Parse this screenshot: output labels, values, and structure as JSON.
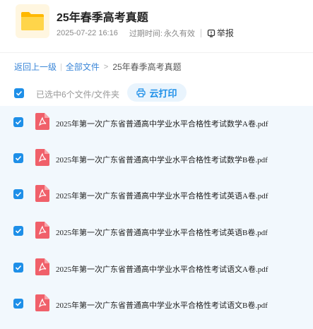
{
  "folder": {
    "title": "25年春季高考真题",
    "date": "2025-07-22 16:16",
    "expire_label": "过期时间:",
    "expire_value": "永久有效",
    "report_label": "举报"
  },
  "breadcrumb": {
    "back": "返回上一级",
    "all_files": "全部文件",
    "current": "25年春季高考真题"
  },
  "toolbar": {
    "selected_text": "已选中6个文件/文件夹",
    "print_label": "云打印"
  },
  "files": [
    {
      "name": "2025年第一次广东省普通高中学业水平合格性考试数学A卷.pdf"
    },
    {
      "name": "2025年第一次广东省普通高中学业水平合格性考试数学B卷.pdf"
    },
    {
      "name": "2025年第一次广东省普通高中学业水平合格性考试英语A卷.pdf"
    },
    {
      "name": "2025年第一次广东省普通高中学业水平合格性考试英语B卷.pdf"
    },
    {
      "name": "2025年第一次广东省普通高中学业水平合格性考试语文A卷.pdf"
    },
    {
      "name": "2025年第一次广东省普通高中学业水平合格性考试语文B卷.pdf"
    }
  ],
  "colors": {
    "accent": "#1e8fe8",
    "pdf_red": "#f0606a",
    "folder_yellow": "#ffc928",
    "list_bg": "#f2f8fd"
  }
}
